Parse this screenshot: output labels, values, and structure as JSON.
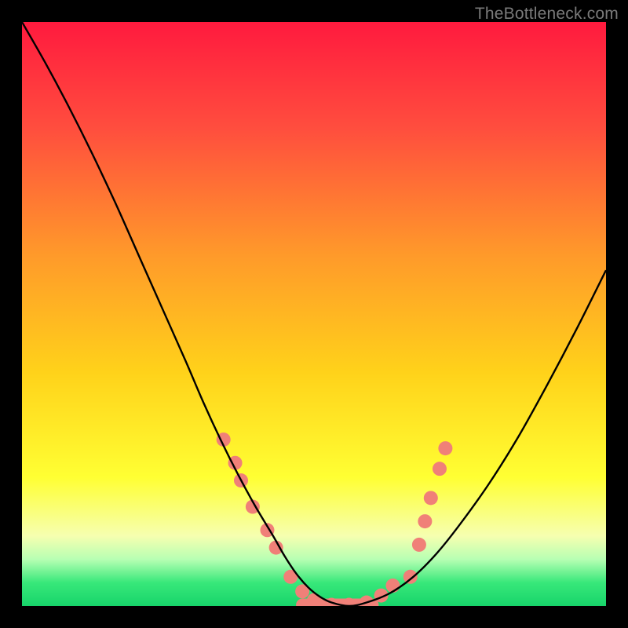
{
  "watermark": "TheBottleneck.com",
  "chart_data": {
    "type": "line",
    "title": "",
    "xlabel": "",
    "ylabel": "",
    "xlim": [
      0,
      100
    ],
    "ylim": [
      0,
      100
    ],
    "background_gradient_stops": [
      {
        "offset": 0,
        "color": "#ff1a3e"
      },
      {
        "offset": 0.18,
        "color": "#ff4d3e"
      },
      {
        "offset": 0.4,
        "color": "#ff9a2a"
      },
      {
        "offset": 0.6,
        "color": "#ffd21a"
      },
      {
        "offset": 0.78,
        "color": "#ffff33"
      },
      {
        "offset": 0.88,
        "color": "#f6ffb0"
      },
      {
        "offset": 0.92,
        "color": "#b7ffb3"
      },
      {
        "offset": 0.96,
        "color": "#38e87a"
      },
      {
        "offset": 1.0,
        "color": "#17d46a"
      }
    ],
    "series": [
      {
        "name": "curve",
        "x": [
          0,
          4,
          8,
          12,
          16,
          20,
          24,
          28,
          31,
          34,
          37,
          40,
          43,
          45,
          47,
          49,
          51,
          53,
          56,
          59,
          63,
          67,
          71,
          75,
          80,
          85,
          90,
          95,
          100
        ],
        "y": [
          100,
          93,
          85.5,
          77.5,
          69,
          60,
          51,
          42,
          35,
          28.5,
          22.5,
          17,
          12,
          8.5,
          5.5,
          3.2,
          1.6,
          0.6,
          0,
          0.6,
          2.2,
          5,
          9,
          14,
          21,
          29,
          38,
          47.5,
          57.5
        ]
      }
    ],
    "markers": {
      "name": "dots",
      "points": [
        {
          "x": 34.5,
          "y": 28.5
        },
        {
          "x": 36.5,
          "y": 24.5
        },
        {
          "x": 37.5,
          "y": 21.5
        },
        {
          "x": 39.5,
          "y": 17.0
        },
        {
          "x": 42.0,
          "y": 13.0
        },
        {
          "x": 43.5,
          "y": 10.0
        },
        {
          "x": 46.0,
          "y": 5.0
        },
        {
          "x": 48.0,
          "y": 2.5
        },
        {
          "x": 50.0,
          "y": 1.0
        },
        {
          "x": 53.0,
          "y": 0.2
        },
        {
          "x": 56.0,
          "y": 0.2
        },
        {
          "x": 59.0,
          "y": 0.6
        },
        {
          "x": 61.5,
          "y": 1.8
        },
        {
          "x": 63.5,
          "y": 3.5
        },
        {
          "x": 66.5,
          "y": 5.0
        },
        {
          "x": 68.0,
          "y": 10.5
        },
        {
          "x": 69.0,
          "y": 14.5
        },
        {
          "x": 70.0,
          "y": 18.5
        },
        {
          "x": 71.5,
          "y": 23.5
        },
        {
          "x": 72.5,
          "y": 27.0
        }
      ],
      "radius": 9,
      "color": "#f08078"
    },
    "flat_band": {
      "x0": 48,
      "x1": 60,
      "y": 0.2,
      "thickness": 16,
      "color": "#f08078"
    }
  }
}
